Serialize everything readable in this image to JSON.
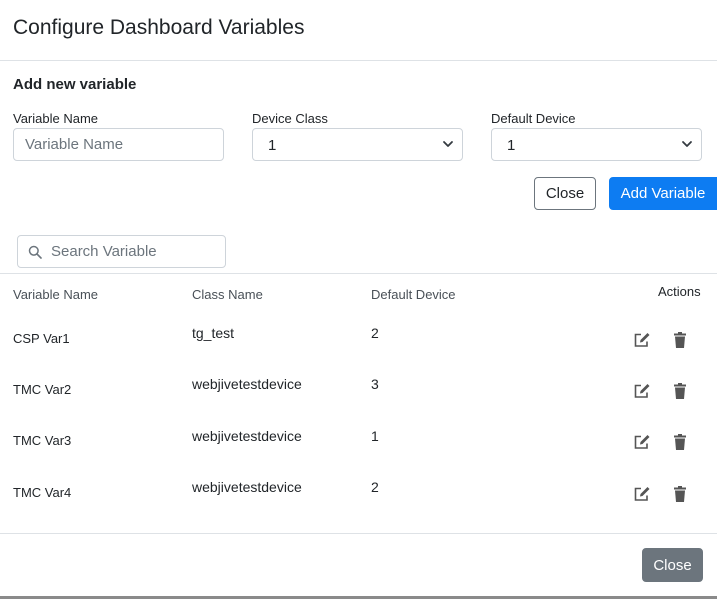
{
  "modal": {
    "title": "Configure Dashboard Variables"
  },
  "form": {
    "section_title": "Add new variable",
    "variable_name_label": "Variable Name",
    "variable_name_placeholder": "Variable Name",
    "device_class_label": "Device Class",
    "device_class_value": "1",
    "default_device_label": "Default Device",
    "default_device_value": "1",
    "close_label": "Close",
    "add_label": "Add Variable"
  },
  "search": {
    "placeholder": "Search Variable",
    "icon": "search-icon"
  },
  "table": {
    "columns": [
      "Variable Name",
      "Class Name",
      "Default Device",
      "Actions"
    ],
    "rows": [
      {
        "variable": "CSP Var1",
        "class": "tg_test",
        "device": "2"
      },
      {
        "variable": "TMC Var2",
        "class": "webjivetestdevice",
        "device": "3"
      },
      {
        "variable": "TMC Var3",
        "class": "webjivetestdevice",
        "device": "1"
      },
      {
        "variable": "TMC Var4",
        "class": "webjivetestdevice",
        "device": "2"
      }
    ],
    "action_icons": [
      "edit-icon",
      "trash-icon"
    ]
  },
  "footer": {
    "close_label": "Close"
  },
  "colors": {
    "primary": "#0d7cf2",
    "secondary": "#6c757d",
    "border": "#dee2e6",
    "icon": "#555555"
  }
}
